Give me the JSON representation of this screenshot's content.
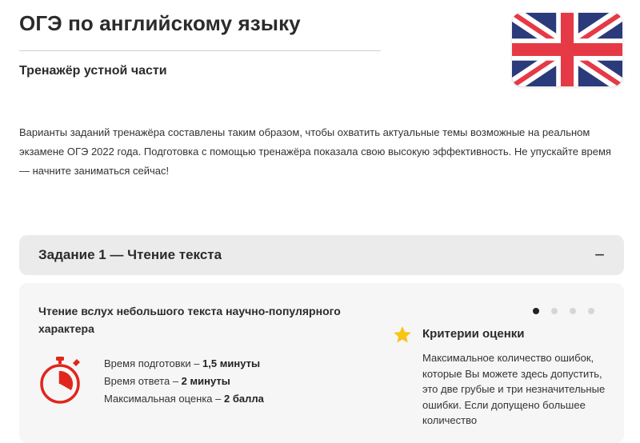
{
  "header": {
    "title": "ОГЭ по английскому языку",
    "subtitle": "Тренажёр устной части",
    "flag_icon": "uk-flag-icon"
  },
  "intro": {
    "text": "Варианты заданий тренажёра составлены таким образом, чтобы охватить актуальные темы возможные на реальном экзамене ОГЭ 2022 года. Подготовка с помощью тренажёра показала свою высокую эффективность. Не упускайте время — начните заниматься сейчас!"
  },
  "accordion": {
    "title": "Задание 1 — Чтение текста",
    "toggle_symbol": "−"
  },
  "task": {
    "heading": "Чтение вслух небольшого текста научно-популярного характера",
    "timer_icon": "stopwatch-icon",
    "stats": [
      {
        "label": "Время подготовки – ",
        "value": "1,5 минуты"
      },
      {
        "label": "Время ответа – ",
        "value": "2 минуты"
      },
      {
        "label": "Максимальная оценка – ",
        "value": "2 балла"
      }
    ],
    "carousel": {
      "total": 4,
      "active_index": 0
    }
  },
  "criteria": {
    "icon": "star-icon",
    "title": "Критерии оценки",
    "text": "Максимальное количество ошибок, которые Вы можете здесь допустить, это две грубые и три незначительные ошибки. Если допущено большее количество"
  },
  "colors": {
    "flag_blue": "#2b3a7a",
    "flag_red": "#e63946",
    "accent_red": "#e1261c",
    "star_yellow": "#f5c518",
    "accordion_bg": "#ebebeb",
    "card_bg": "#f6f6f6"
  }
}
